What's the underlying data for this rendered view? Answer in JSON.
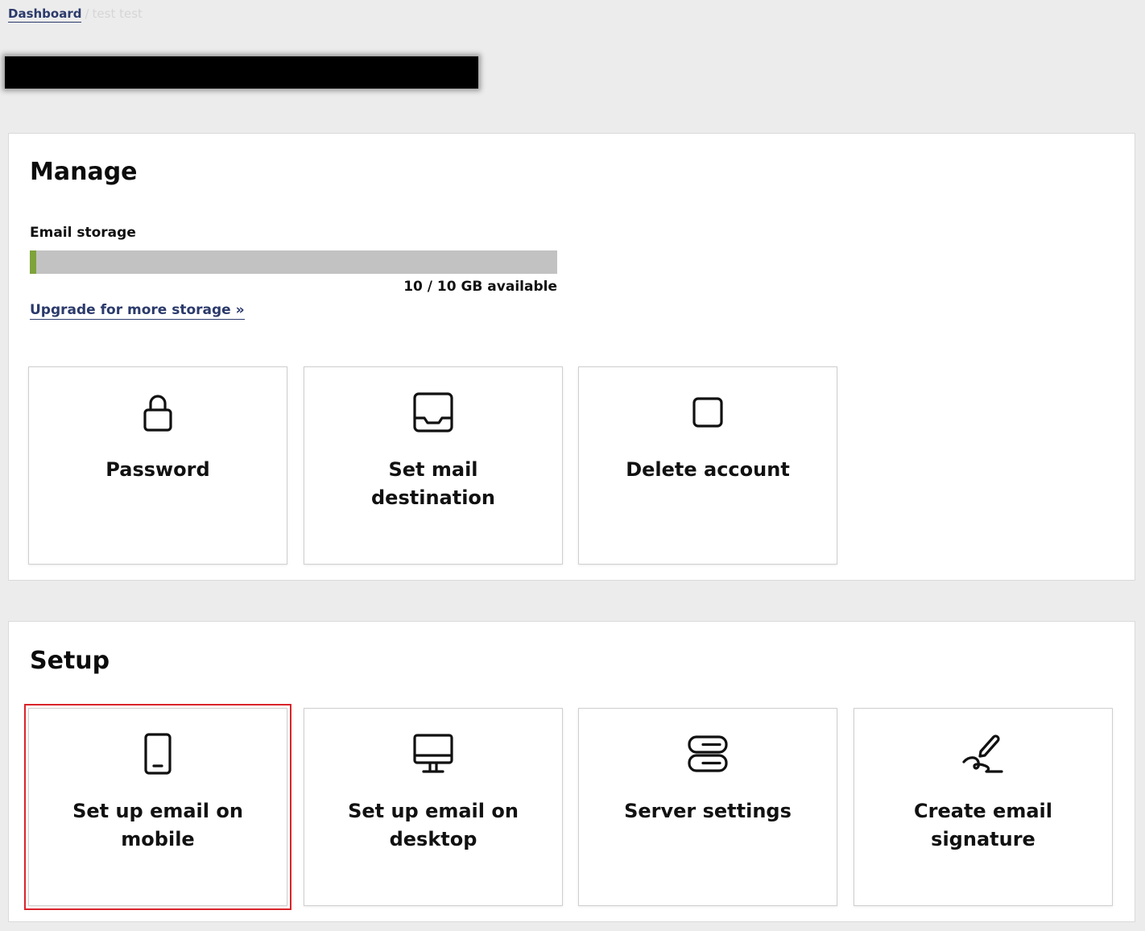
{
  "breadcrumb": {
    "home": "Dashboard",
    "separator": "/",
    "current": "test test"
  },
  "manage": {
    "title": "Manage",
    "storage": {
      "label": "Email storage",
      "used_fraction": 0.012,
      "available_text": "10 / 10 GB available",
      "bar_color": "#c2c2c2",
      "fill_color": "#7ea33b"
    },
    "upgrade_link": "Upgrade for more storage »",
    "cards": [
      {
        "label": "Password",
        "icon": "lock-icon"
      },
      {
        "label": "Set mail destination",
        "icon": "inbox-tray-icon"
      },
      {
        "label": "Delete account",
        "icon": "square-icon"
      }
    ]
  },
  "setup": {
    "title": "Setup",
    "cards": [
      {
        "label": "Set up email on mobile",
        "icon": "mobile-phone-icon",
        "selected": true
      },
      {
        "label": "Set up email on desktop",
        "icon": "desktop-monitor-icon"
      },
      {
        "label": "Server settings",
        "icon": "server-icon"
      },
      {
        "label": "Create email signature",
        "icon": "signature-pen-icon"
      }
    ]
  },
  "colors": {
    "link": "#2b3a6b",
    "selection_outline": "#d9232a",
    "page_background": "#ececec"
  }
}
